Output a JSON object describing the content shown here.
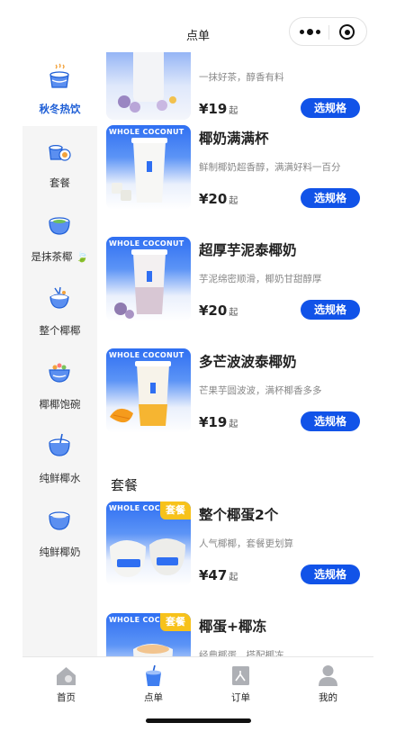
{
  "header": {
    "title": "点单"
  },
  "sidebar": {
    "items": [
      {
        "label": "秋冬热饮",
        "icon": "hot-drink-cup-icon",
        "active": true
      },
      {
        "label": "套餐",
        "icon": "combo-set-icon",
        "active": false
      },
      {
        "label": "是抹茶椰",
        "icon": "matcha-coconut-icon",
        "badge_icon": "leaf-icon",
        "active": false
      },
      {
        "label": "整个椰椰",
        "icon": "whole-coconut-icon",
        "active": false
      },
      {
        "label": "椰椰饱碗",
        "icon": "coconut-bowl-icon",
        "active": false
      },
      {
        "label": "纯鲜椰水",
        "icon": "coconut-water-icon",
        "active": false
      },
      {
        "label": "纯鲜椰奶",
        "icon": "coconut-milk-icon",
        "active": false
      }
    ]
  },
  "thumb_brand": "WHOLE COCONUT",
  "products": [
    {
      "name": "",
      "desc": "一抹好茶，醇香有料",
      "price": "¥19",
      "suffix": "起",
      "button": "选规格"
    },
    {
      "name": "椰奶满满杯",
      "desc": "鲜制椰奶超香醇，满满好料一百分",
      "price": "¥20",
      "suffix": "起",
      "button": "选规格"
    },
    {
      "name": "超厚芋泥泰椰奶",
      "desc": "芋泥绵密顺滑，椰奶甘甜醇厚",
      "price": "¥20",
      "suffix": "起",
      "button": "选规格"
    },
    {
      "name": "多芒波波泰椰奶",
      "desc": "芒果芋圆波波，满杯椰香多多",
      "price": "¥19",
      "suffix": "起",
      "button": "选规格"
    }
  ],
  "combo_section": {
    "title": "套餐",
    "items": [
      {
        "name": "整个椰蛋2个",
        "desc": "人气椰椰，套餐更划算",
        "price": "¥47",
        "suffix": "起",
        "button": "选规格",
        "tag": "套餐"
      },
      {
        "name": "椰蛋+椰冻",
        "desc": "经典椰蛋，搭配椰冻",
        "price": "",
        "suffix": "",
        "button": "",
        "tag": "套餐"
      }
    ]
  },
  "tabbar": {
    "tabs": [
      {
        "label": "首页",
        "icon": "home-icon"
      },
      {
        "label": "点单",
        "icon": "order-cup-icon",
        "active": true
      },
      {
        "label": "订单",
        "icon": "orders-list-icon"
      },
      {
        "label": "我的",
        "icon": "profile-icon"
      }
    ]
  },
  "colors": {
    "accent": "#1153e8",
    "active_label": "#1f5fd6",
    "tag": "#f7c21b",
    "sidebar_bg": "#f5f5f5"
  }
}
